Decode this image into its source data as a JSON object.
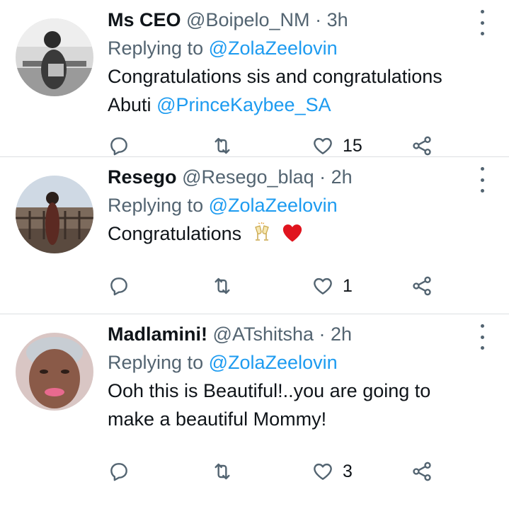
{
  "tweets": [
    {
      "name": "Ms CEO",
      "handle": "@Boipelo_NM",
      "time": "3h",
      "replying_prefix": "Replying to",
      "replying_to": "@ZolaZeelovin",
      "text": "Congratulations sis and congratulations Abuti",
      "text_mention": "@PrinceKaybee_SA",
      "like_count": "15"
    },
    {
      "name": "Resego",
      "handle": "@Resego_blaq",
      "time": "2h",
      "replying_prefix": "Replying to",
      "replying_to": "@ZolaZeelovin",
      "text": "Congratulations",
      "emoji": [
        "clinking-glasses-emoji",
        "red-heart-emoji"
      ],
      "like_count": "1"
    },
    {
      "name": "Madlamini!",
      "handle": "@ATshitsha",
      "time": "2h",
      "replying_prefix": "Replying to",
      "replying_to": "@ZolaZeelovin",
      "text": "Ooh this is Beautiful!..you are going to make a beautiful Mommy!",
      "like_count": "3"
    }
  ],
  "separator": "·",
  "icons": [
    "reply-icon",
    "retweet-icon",
    "like-icon",
    "share-icon",
    "more-icon"
  ],
  "colors": {
    "link": "#1d9bf0",
    "muted": "#536471",
    "text": "#0f1419",
    "heart": "#e0141e"
  }
}
